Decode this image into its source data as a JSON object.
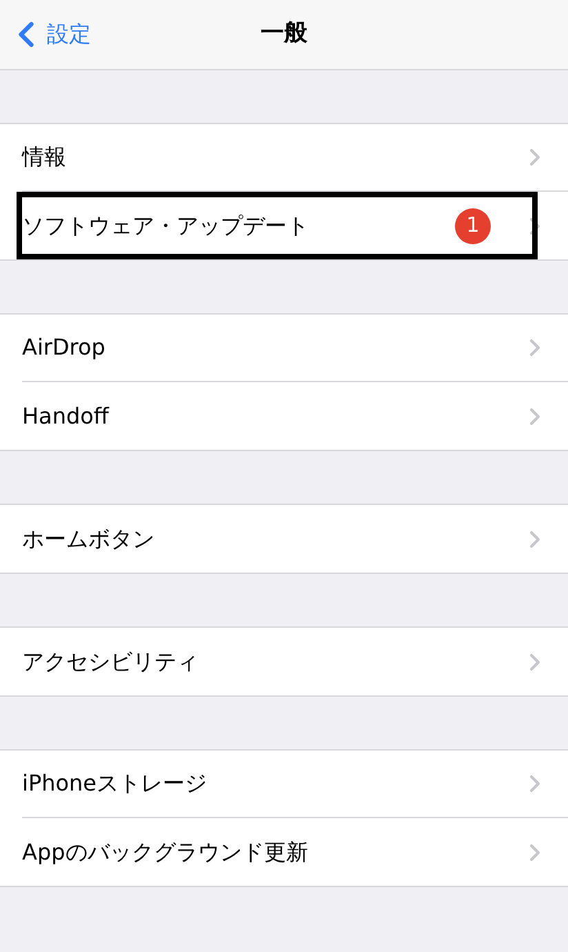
{
  "nav": {
    "back_label": "設定",
    "title": "一般"
  },
  "groups": [
    {
      "rows": [
        {
          "label": "情報",
          "highlighted": false
        },
        {
          "label": "ソフトウェア・アップデート",
          "badge": "1",
          "highlighted": true
        }
      ]
    },
    {
      "rows": [
        {
          "label": "AirDrop",
          "highlighted": false
        },
        {
          "label": "Handoff",
          "highlighted": false
        }
      ]
    },
    {
      "rows": [
        {
          "label": "ホームボタン",
          "highlighted": false
        }
      ]
    },
    {
      "rows": [
        {
          "label": "アクセシビリティ",
          "highlighted": false
        }
      ]
    },
    {
      "rows": [
        {
          "label": "iPhoneストレージ",
          "highlighted": false
        },
        {
          "label": "Appのバックグラウンド更新",
          "highlighted": false
        }
      ]
    }
  ]
}
